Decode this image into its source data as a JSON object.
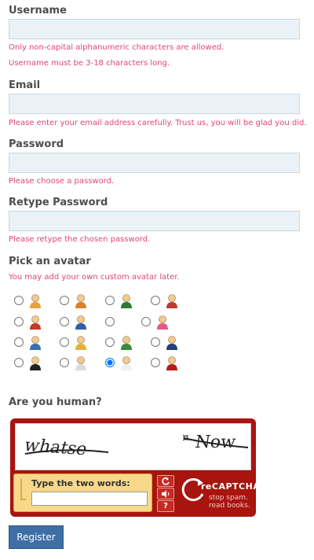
{
  "form": {
    "username": {
      "label": "Username",
      "value": "",
      "help": [
        "Only non-capital alphanumeric characters are allowed.",
        "Username must be 3-18 characters long."
      ]
    },
    "email": {
      "label": "Email",
      "value": "",
      "help": [
        "Please enter your email address carefully. Trust us, you will be glad you did."
      ]
    },
    "password": {
      "label": "Password",
      "value": "",
      "help": [
        "Please choose a password."
      ]
    },
    "retype_password": {
      "label": "Retype Password",
      "value": "",
      "help": [
        "Please retype the chosen password."
      ]
    },
    "avatar": {
      "label": "Pick an avatar",
      "help": "You may add your own custom avatar later.",
      "selected_index": 14,
      "options": [
        {
          "icon": "man-green-shirt-avatar-icon",
          "color": "#e8a33a"
        },
        {
          "icon": "woman-orange-avatar-icon",
          "color": "#d9822b"
        },
        {
          "icon": "man-dark-green-avatar-icon",
          "color": "#2f7a3a"
        },
        {
          "icon": "woman-red-avatar-icon",
          "color": "#c0392b"
        },
        {
          "icon": "man-red-cap-avatar-icon",
          "color": "#c0392b"
        },
        {
          "icon": "woman-blue-avatar-icon",
          "color": "#2f5fa8"
        },
        {
          "icon": "blank-avatar",
          "color": ""
        },
        {
          "icon": "girl-pink-avatar-icon",
          "color": "#e05a8a"
        },
        {
          "icon": "couple-avatar-icon",
          "color": "#3b6fb0"
        },
        {
          "icon": "blonde-woman-avatar-icon",
          "color": "#e1b23a"
        },
        {
          "icon": "man-red-hat-avatar-icon",
          "color": "#3a8a3a"
        },
        {
          "icon": "woman-dark-blue-avatar-icon",
          "color": "#233f7a"
        },
        {
          "icon": "ninja-avatar-icon",
          "color": "#222222"
        },
        {
          "icon": "ghost-avatar-icon",
          "color": "#dcdcdc"
        },
        {
          "icon": "angel-avatar-icon",
          "color": "#f0f0f0"
        },
        {
          "icon": "devil-avatar-icon",
          "color": "#b3201c"
        }
      ]
    },
    "captcha": {
      "label": "Are you human?",
      "words": [
        "whatse",
        "Now"
      ],
      "prompt": "Type the two words:",
      "value": "",
      "reload_icon": "refresh-icon",
      "audio_icon": "audio-icon",
      "help_icon": "?",
      "brand": "reCAPTCHA",
      "tagline": [
        "stop spam.",
        "read books."
      ]
    },
    "submit_label": "Register"
  },
  "colors": {
    "help_text": "#e0447a",
    "input_bg": "#eaf2f7",
    "captcha_red": "#a8140e",
    "button_blue": "#3f6ea5"
  }
}
